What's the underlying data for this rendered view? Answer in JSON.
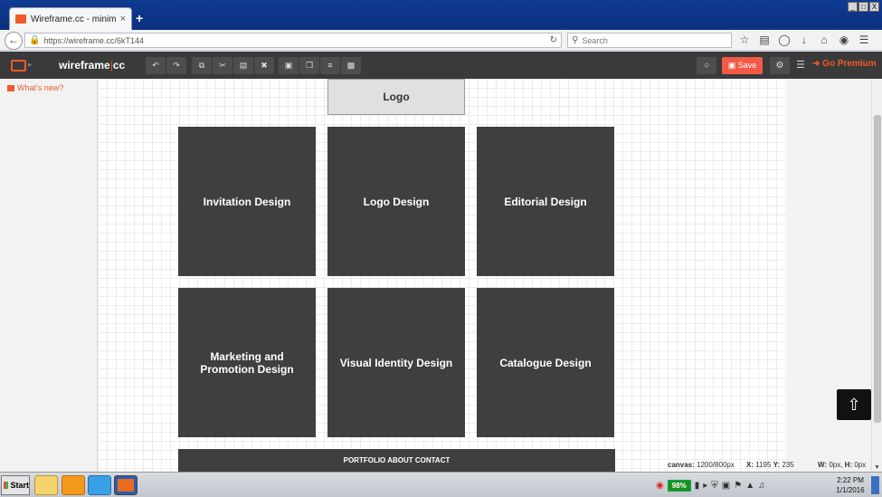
{
  "browser": {
    "tab_title": "Wireframe.cc - minimal wirefr...",
    "tab_close": "×",
    "new_tab": "+",
    "url": "https://wireframe.cc/6kT144",
    "search_placeholder": "Search",
    "window_controls": [
      "_",
      "□",
      "X"
    ]
  },
  "app": {
    "brand_left": "wireframe",
    "brand_sep": "|",
    "brand_right": "cc",
    "save_label": "Save",
    "premium_label": "Go Premium",
    "whats_new": "What's new?"
  },
  "wireframe": {
    "logo_label": "Logo",
    "tiles": [
      "Invitation Design",
      "Logo Design",
      "Editorial Design",
      "Marketing and Promotion Design",
      "Visual Identity Design",
      "Catalogue Design"
    ],
    "footer_text": "PORTFOLIO ABOUT CONTACT"
  },
  "status": {
    "canvas_label": "canvas:",
    "canvas_value": "1200/800px",
    "x_label": "X:",
    "x_value": "1195",
    "y_label": "Y:",
    "y_value": "235",
    "w_label": "W:",
    "w_value": "0px,",
    "h_label": "H:",
    "h_value": "0px"
  },
  "taskbar": {
    "start_label": "Start",
    "battery": "98%",
    "clock_time": "2:22 PM",
    "clock_date": "1/1/2016"
  },
  "colors": {
    "accent": "#f05a28",
    "save": "#f25a45",
    "tile": "#3f3f3f"
  }
}
